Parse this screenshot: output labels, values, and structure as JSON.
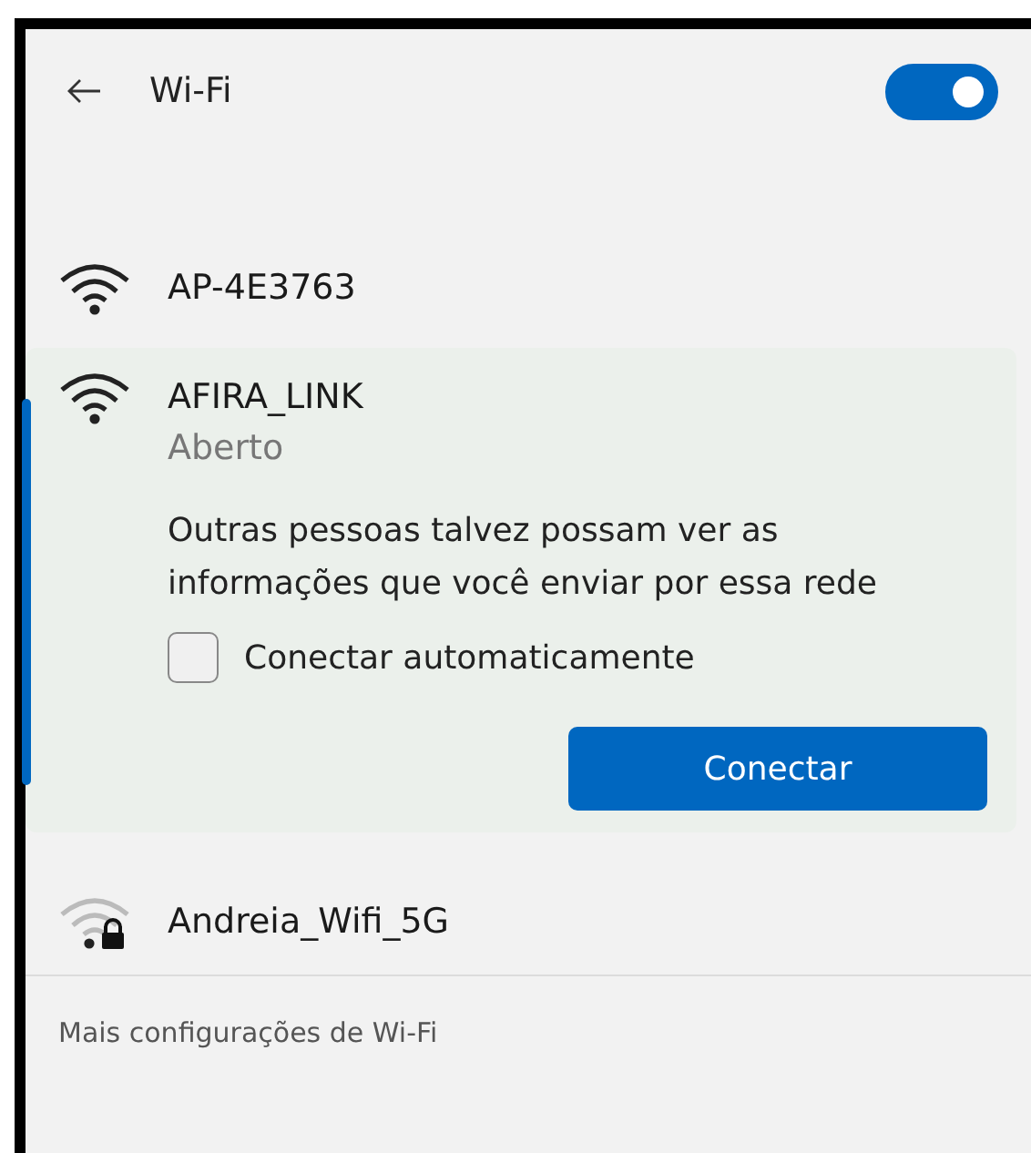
{
  "header": {
    "title": "Wi-Fi",
    "wifi_on": true
  },
  "networks": [
    {
      "name": "AP-4E3763",
      "secured": false,
      "expanded": false
    },
    {
      "name": "AFIRA_LINK",
      "secured": false,
      "expanded": true,
      "selected": true,
      "status": "Aberto",
      "warning": "Outras pessoas talvez possam ver as informações que você enviar por essa rede",
      "auto_connect": {
        "label": "Conectar automaticamente",
        "checked": false
      },
      "action": "Conectar"
    },
    {
      "name": "Andreia_Wifi_5G",
      "secured": true,
      "expanded": false
    }
  ],
  "footer": {
    "link": "Mais configurações de Wi-Fi"
  }
}
